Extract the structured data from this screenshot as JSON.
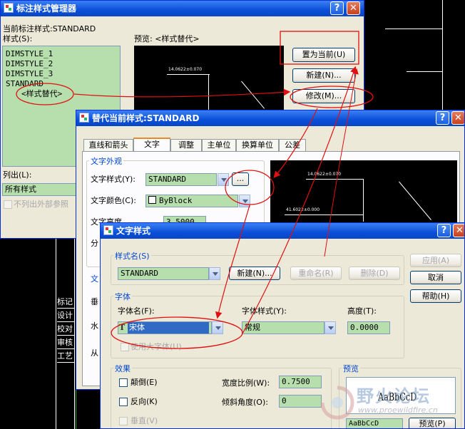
{
  "mgr": {
    "title": "标注样式管理器",
    "current_label": "当前标注样式:STANDARD",
    "styles_label": "样式(S):",
    "styles": [
      "DIMSTYLE_1",
      "DIMSTYLE_2",
      "DIMSTYLE_3",
      "STANDARD"
    ],
    "selected_style": "<样式替代>",
    "preview_label": "预览: <样式替代>",
    "set_current": "置为当前(U)",
    "new": "新建(N)...",
    "modify": "修改(M)...",
    "list_label": "列出(L):",
    "list_value": "所有样式",
    "xref_label": "不列出外部参照"
  },
  "override": {
    "title": "替代当前样式:STANDARD",
    "tabs": [
      "直线和箭头",
      "文字",
      "调整",
      "主单位",
      "换算单位",
      "公差"
    ],
    "active_tab": "文字",
    "group_appearance": "文字外观",
    "text_style_label": "文字样式(Y):",
    "text_style_value": "STANDARD",
    "text_style_btn": "...",
    "text_color_label": "文字颜色(C):",
    "text_color_value": "ByBlock",
    "text_height_label": "文字高度",
    "text_height_value": "3.5000",
    "fraction_label": "分",
    "partial_label_1": "文",
    "partial_label_2": "垂",
    "partial_label_3": "水",
    "partial_label_4": "从",
    "preview_dim_1": "14.0622±0.070",
    "preview_dim_2": "41.6022±0.000"
  },
  "textstyle": {
    "title": "文字样式",
    "group_stylename": "样式名(S)",
    "stylename_value": "STANDARD",
    "new_btn": "新建(N)...",
    "rename_btn": "重命名(R)",
    "delete_btn": "删除(D)",
    "apply_btn": "应用(A)",
    "cancel_btn": "取消",
    "help_btn": "帮助(H)",
    "group_font": "字体",
    "fontname_label": "字体名(F):",
    "fontname_value": "宋体",
    "fontname_icon": "T",
    "fontstyle_label": "字体样式(Y):",
    "fontstyle_value": "常规",
    "height_label": "高度(T):",
    "height_value": "0.0000",
    "bigfont_label": "使用大字体(U)",
    "group_effects": "效果",
    "upsidedown_label": "颠倒(E)",
    "backwards_label": "反向(K)",
    "vertical_label": "垂直(V)",
    "width_label": "宽度比例(W):",
    "width_value": "0.7500",
    "oblique_label": "倾斜角度(O):",
    "oblique_value": "0",
    "group_preview": "预览",
    "preview_sample": "AaBbCcD",
    "preview_input": "AaBbCcD",
    "preview_btn": "预览(P)"
  },
  "cad_table": [
    "标记",
    "设计",
    "校对",
    "审核",
    "工艺"
  ],
  "watermark": {
    "cn": "野火论坛",
    "url": "www.proewildfire.cn"
  },
  "colors": {
    "annotation_red": "#e01010",
    "field_green": "#b7dfae",
    "xp_blue": "#0a4fd8"
  }
}
